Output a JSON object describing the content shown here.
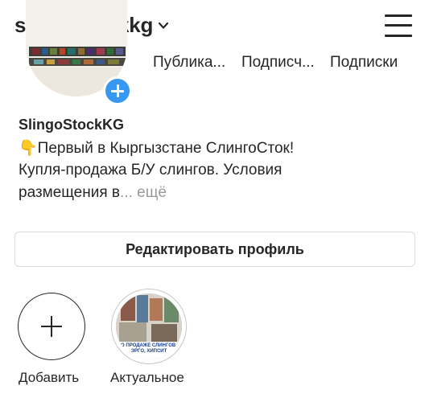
{
  "header": {
    "username": "slingostockkg",
    "chevron_icon": "chevron-down-icon",
    "menu_icon": "hamburger-menu-icon"
  },
  "profile": {
    "avatar_badge_icon": "plus-icon",
    "stats": [
      {
        "label": "Публика..."
      },
      {
        "label": "Подписч..."
      },
      {
        "label": "Подписки"
      }
    ]
  },
  "bio": {
    "name": "SlingoStockKG",
    "line1_emoji": "👇",
    "line1": "Первый в Кыргызстане СлингоСток!",
    "line2": "Купля-продажа Б/У слингов. Условия",
    "line3": "размещения в",
    "more": "... ещё"
  },
  "edit_profile": {
    "label": "Редактировать профиль"
  },
  "highlights": {
    "add_label": "Добавить",
    "add_icon": "plus-icon",
    "items": [
      {
        "label": "Актуальное",
        "thumb_text": "О ПРОДАЖЕ СЛИНГОВ, ЭРГО, ХИПСИТ"
      }
    ]
  },
  "colors": {
    "accent": "#3897f0",
    "text": "#262626",
    "muted": "#999999",
    "border": "#dbdbdb"
  }
}
